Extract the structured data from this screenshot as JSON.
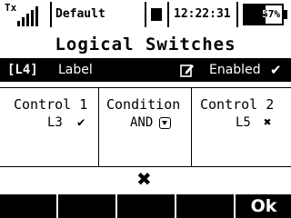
{
  "status_bar": {
    "tx_label": "Tx",
    "signal_bars": 5,
    "model_name": "Default",
    "time": "12:22:31",
    "battery_percent": 57,
    "battery_text": "57%"
  },
  "screen": {
    "title": "Logical Switches"
  },
  "selected_row": {
    "index": "[L4]",
    "label": "Label",
    "edit_icon": "edit-icon",
    "status": "Enabled",
    "status_icon": "check-icon"
  },
  "columns": [
    {
      "header": "Control 1",
      "value": "L3",
      "icon": "check-icon",
      "glyph": "✔"
    },
    {
      "header": "Condition",
      "value": "AND",
      "icon": "dropdown-icon"
    },
    {
      "header": "Control 2",
      "value": "L5",
      "icon": "cross-icon",
      "glyph": "✖"
    }
  ],
  "delete_icon": "✖",
  "softkeys": [
    "",
    "",
    "",
    "",
    "Ok"
  ]
}
